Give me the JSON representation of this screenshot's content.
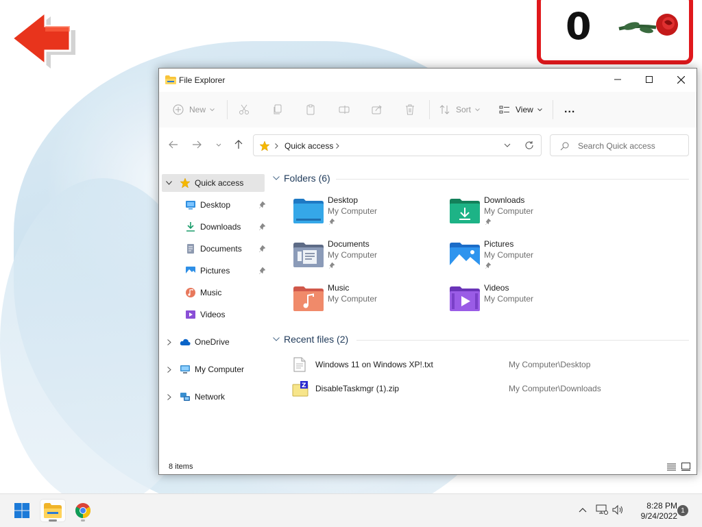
{
  "overlay": {
    "score": "0"
  },
  "window": {
    "title": "File Explorer"
  },
  "toolbar": {
    "new_label": "New",
    "sort_label": "Sort",
    "view_label": "View",
    "more_label": "..."
  },
  "address": {
    "breadcrumb": "Quick access",
    "search_placeholder": "Search Quick access"
  },
  "nav": {
    "items": [
      {
        "label": "Quick access",
        "icon": "star-icon"
      },
      {
        "label": "Desktop",
        "icon": "desktop-icon"
      },
      {
        "label": "Downloads",
        "icon": "download-icon"
      },
      {
        "label": "Documents",
        "icon": "document-icon"
      },
      {
        "label": "Pictures",
        "icon": "picture-icon"
      },
      {
        "label": "Music",
        "icon": "music-icon"
      },
      {
        "label": "Videos",
        "icon": "video-icon"
      },
      {
        "label": "OneDrive",
        "icon": "cloud-icon"
      },
      {
        "label": "My Computer",
        "icon": "computer-icon"
      },
      {
        "label": "Network",
        "icon": "network-icon"
      }
    ]
  },
  "folders": {
    "header": "Folders (6)",
    "items": [
      {
        "name": "Desktop",
        "location": "My Computer"
      },
      {
        "name": "Downloads",
        "location": "My Computer"
      },
      {
        "name": "Documents",
        "location": "My Computer"
      },
      {
        "name": "Pictures",
        "location": "My Computer"
      },
      {
        "name": "Music",
        "location": "My Computer"
      },
      {
        "name": "Videos",
        "location": "My Computer"
      }
    ]
  },
  "recent": {
    "header": "Recent files (2)",
    "items": [
      {
        "name": "Windows 11 on Windows XP!.txt",
        "location": "My Computer\\Desktop"
      },
      {
        "name": "DisableTaskmgr (1).zip",
        "location": "My Computer\\Downloads"
      }
    ]
  },
  "status": {
    "item_count": "8 items"
  },
  "taskbar": {
    "time": "8:28 PM",
    "date": "9/24/2022",
    "notification_count": "1"
  },
  "colors": {
    "accent": "#0067c0",
    "score_border": "#e0181c",
    "arrow": "#e8341c"
  }
}
